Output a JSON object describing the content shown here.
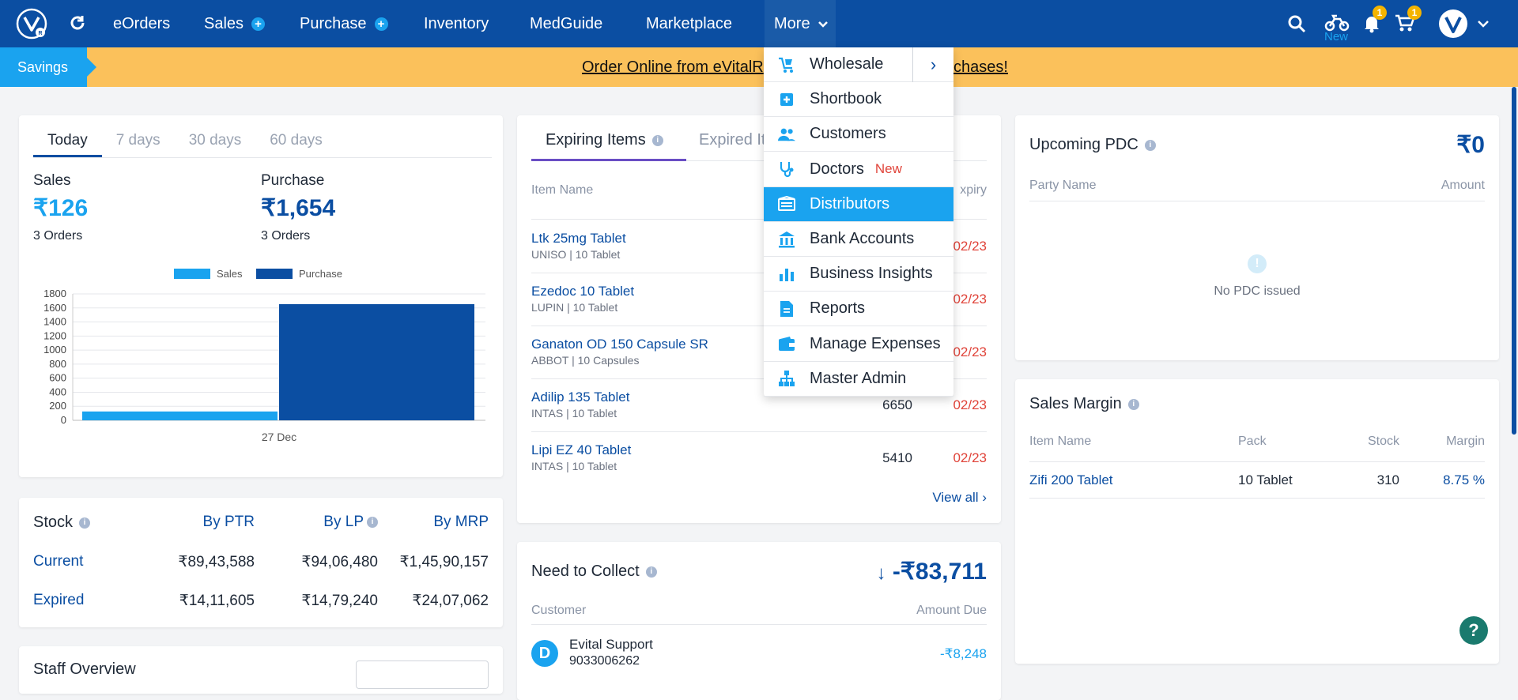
{
  "nav": {
    "items": [
      {
        "label": "eOrders"
      },
      {
        "label": "Sales",
        "plus": "+"
      },
      {
        "label": "Purchase",
        "plus": "+"
      },
      {
        "label": "Inventory"
      },
      {
        "label": "MedGuide"
      },
      {
        "label": "Marketplace"
      },
      {
        "label": "More"
      }
    ],
    "delivery_new": "New",
    "notification_count": "1",
    "cart_count": "1"
  },
  "savings": {
    "tag": "Savings",
    "link_left": "Order Online from eVitalR",
    "link_right": "chases!"
  },
  "sales_card": {
    "tabs": [
      "Today",
      "7 days",
      "30 days",
      "60 days"
    ],
    "sales_label": "Sales",
    "sales_value": "₹126",
    "sales_orders": "3 Orders",
    "purchase_label": "Purchase",
    "purchase_value": "₹1,654",
    "purchase_orders": "3 Orders"
  },
  "chart_data": {
    "type": "bar",
    "categories": [
      "27 Dec"
    ],
    "series": [
      {
        "name": "Sales",
        "values": [
          126
        ],
        "color": "#1aa3ef"
      },
      {
        "name": "Purchase",
        "values": [
          1654
        ],
        "color": "#0b4ea2"
      }
    ],
    "ylim": [
      0,
      1800
    ],
    "yticks": [
      "0",
      "200",
      "400",
      "600",
      "800",
      "1000",
      "1200",
      "1400",
      "1600",
      "1800"
    ],
    "legend": "top-center",
    "grid": true
  },
  "stock": {
    "title": "Stock",
    "cols": [
      "By PTR",
      "By LP",
      "By MRP"
    ],
    "rows": [
      {
        "label": "Current",
        "values": [
          "₹89,43,588",
          "₹94,06,480",
          "₹1,45,90,157"
        ]
      },
      {
        "label": "Expired",
        "values": [
          "₹14,11,605",
          "₹14,79,240",
          "₹24,07,062"
        ]
      }
    ]
  },
  "staff": {
    "title": "Staff Overview"
  },
  "expiring": {
    "tabs": [
      "Expiring Items",
      "Expired It"
    ],
    "col_item": "Item Name",
    "col_expiry": "xpiry",
    "items": [
      {
        "name": "Ltk 25mg Tablet",
        "sub": "UNISO | 10 Tablet",
        "qty": "",
        "expiry": "02/23"
      },
      {
        "name": "Ezedoc 10 Tablet",
        "sub": "LUPIN | 10 Tablet",
        "qty": "",
        "expiry": "02/23"
      },
      {
        "name": "Ganaton OD 150 Capsule SR",
        "sub": "ABBOT | 10 Capsules",
        "qty": "",
        "expiry": "02/23"
      },
      {
        "name": "Adilip 135 Tablet",
        "sub": "INTAS | 10 Tablet",
        "qty": "6650",
        "expiry": "02/23"
      },
      {
        "name": "Lipi EZ 40 Tablet",
        "sub": "INTAS | 10 Tablet",
        "qty": "5410",
        "expiry": "02/23"
      }
    ],
    "view_all": "View all"
  },
  "collect": {
    "title": "Need to Collect",
    "amount": "-₹83,711",
    "col_customer": "Customer",
    "col_amount": "Amount Due",
    "rows": [
      {
        "initial": "D",
        "name": "Evital Support",
        "phone": "9033006262",
        "amount": "-₹8,248"
      }
    ]
  },
  "pdc": {
    "title": "Upcoming PDC",
    "amount": "₹0",
    "col_party": "Party Name",
    "col_amount": "Amount",
    "empty": "No PDC issued"
  },
  "margin": {
    "title": "Sales Margin",
    "cols": [
      "Item Name",
      "Pack",
      "Stock",
      "Margin"
    ],
    "rows": [
      {
        "name": "Zifi 200 Tablet",
        "pack": "10 Tablet",
        "stock": "310",
        "margin": "8.75 %"
      }
    ]
  },
  "more_menu": {
    "items": [
      {
        "label": "Wholesale",
        "icon": "cart-icon"
      },
      {
        "label": "Shortbook",
        "icon": "plus-square-icon"
      },
      {
        "label": "Customers",
        "icon": "users-icon"
      },
      {
        "label": "Doctors",
        "icon": "stethoscope-icon",
        "badge": "New"
      },
      {
        "label": "Distributors",
        "icon": "truck-icon"
      },
      {
        "label": "Bank Accounts",
        "icon": "bank-icon"
      },
      {
        "label": "Business Insights",
        "icon": "bar-chart-icon"
      },
      {
        "label": "Reports",
        "icon": "document-icon"
      },
      {
        "label": "Manage Expenses",
        "icon": "wallet-icon"
      },
      {
        "label": "Master Admin",
        "icon": "hierarchy-icon"
      }
    ]
  },
  "help": "?"
}
